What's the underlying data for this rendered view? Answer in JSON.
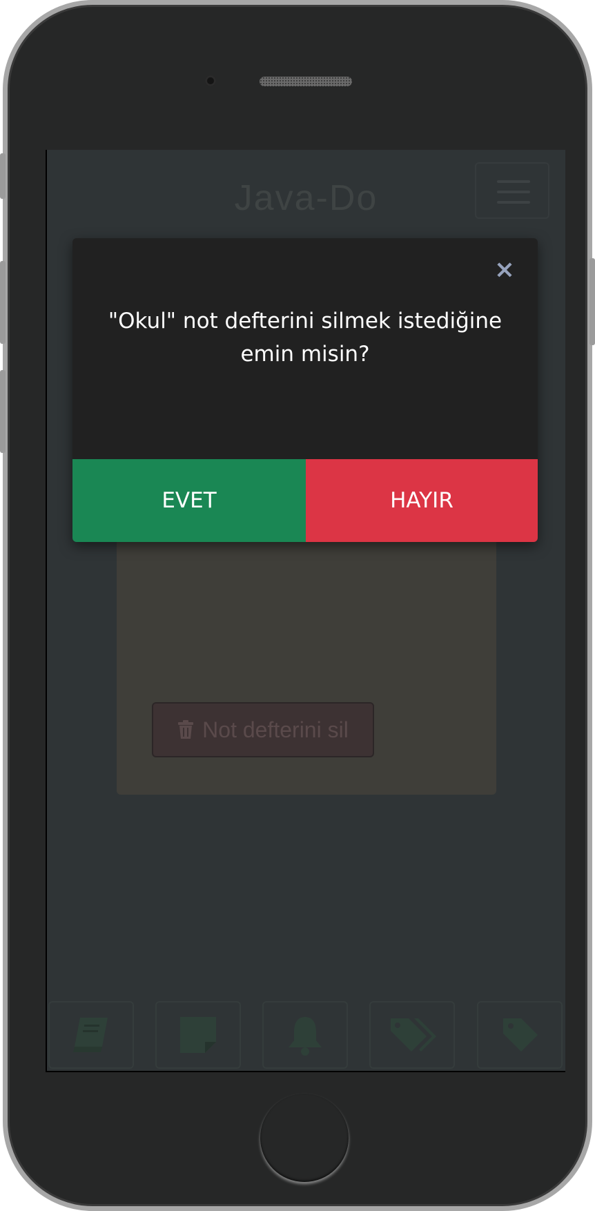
{
  "app": {
    "title": "Java-Do"
  },
  "header": {
    "menu_icon": "hamburger-icon"
  },
  "notebook_card": {
    "delete_button_label": "Not defterini sil",
    "delete_icon": "trash-icon"
  },
  "bottom_nav": {
    "items": [
      {
        "icon": "notebook-icon"
      },
      {
        "icon": "note-icon"
      },
      {
        "icon": "bell-icon"
      },
      {
        "icon": "tags-icon"
      },
      {
        "icon": "tag-icon"
      }
    ]
  },
  "modal": {
    "close_icon": "close-icon",
    "message_line1": "\"Okul\" not defterini silmek istediğine",
    "message_line2": "emin misin?",
    "yes_label": "EVET",
    "no_label": "HAYIR"
  },
  "colors": {
    "yes": "#1a8754",
    "no": "#dc3545",
    "modal_bg": "#212121",
    "screen_bg": "#2f3436",
    "close": "#97a3bd"
  }
}
